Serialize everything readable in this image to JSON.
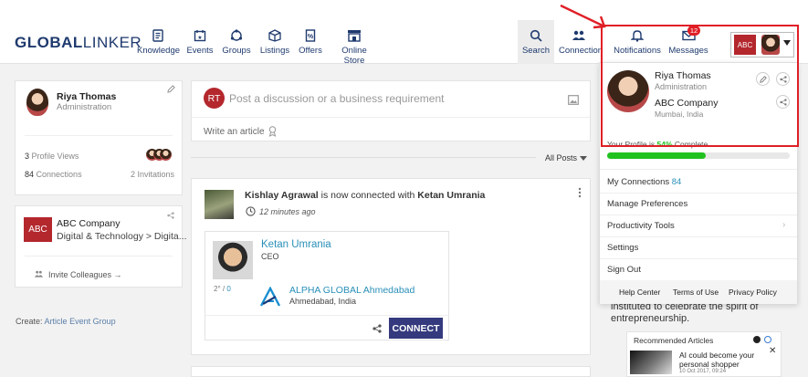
{
  "header": {
    "logo_part1": "GLOBAL",
    "logo_part2": "LINKER",
    "nav": {
      "knowledge": "Knowledge",
      "events": "Events",
      "groups": "Groups",
      "listings": "Listings",
      "offers": "Offers",
      "online_store": "Online Store",
      "search": "Search",
      "connections": "Connection",
      "notifications": "Notifications",
      "messages": "Messages"
    },
    "messages_badge": "12",
    "profile_logo": "ABC"
  },
  "profile_card": {
    "name": "Riya Thomas",
    "role": "Administration",
    "profile_views_count": "3",
    "profile_views_label": "Profile Views",
    "connections_count": "84",
    "connections_label": "Connections",
    "invitations": "2 Invitations"
  },
  "company_card": {
    "logo": "ABC",
    "name": "ABC Company",
    "category": "Digital & Technology > Digita...",
    "invite": "Invite Colleagues →"
  },
  "create": {
    "label": "Create:",
    "article": "Article",
    "event": "Event",
    "group": "Group"
  },
  "composer": {
    "avatar_initials": "RT",
    "placeholder": "Post a discussion or a business requirement",
    "write_article": "Write an article"
  },
  "filter": {
    "label": "All Posts"
  },
  "feed_post": {
    "actor": "Kishlay Agrawal",
    "action": " is now connected with ",
    "target": "Ketan Umrania",
    "time": "12 minutes ago",
    "person_name": "Ketan Umrania",
    "person_title": "CEO",
    "degree": "2° / ",
    "mutual": "0",
    "company_name": "ALPHA GLOBAL Ahmedabad",
    "company_location": "Ahmedabad, India",
    "connect_button": "CONNECT"
  },
  "dropdown": {
    "name": "Riya Thomas",
    "role": "Administration",
    "company": "ABC Company",
    "location": "Mumbai, India",
    "completion_prefix": "Your Profile is ",
    "completion_percent": "54%",
    "completion_suffix": " Complete",
    "progress": 0.54,
    "menu": {
      "my_connections": "My Connections",
      "connections_count": "84",
      "manage_preferences": "Manage Preferences",
      "productivity_tools": "Productivity Tools",
      "settings": "Settings",
      "sign_out": "Sign Out"
    },
    "footer": {
      "help_center": "Help Center",
      "terms": "Terms of Use",
      "privacy": "Privacy Policy"
    }
  },
  "right_panel": {
    "text_line1": "instituted to celebrate the spirit of",
    "text_line2": "entrepreneurship.",
    "recommended_title": "Recommended Articles",
    "article_title": "AI could become your personal shopper",
    "article_date": "10 Oct 2017, 09:24"
  },
  "colors": {
    "brand_navy": "#1f3a6e",
    "accent_teal": "#2a8fb8",
    "progress_green": "#21c21f",
    "highlight_red": "#e01e26",
    "connect_button": "#343a7d"
  }
}
